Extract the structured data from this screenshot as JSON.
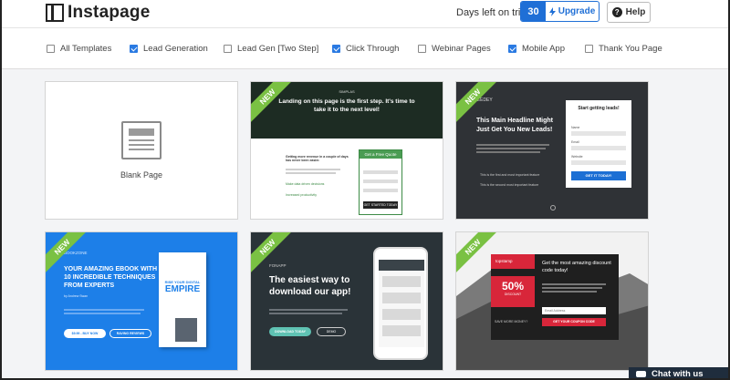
{
  "header": {
    "logo_text": "Instapage",
    "trial_label": "Days left on trial:",
    "trial_days": "30",
    "upgrade_label": "Upgrade",
    "help_label": "Help",
    "help_icon_glyph": "?"
  },
  "filters": [
    {
      "label": "All Templates",
      "checked": false
    },
    {
      "label": "Lead Generation",
      "checked": true
    },
    {
      "label": "Lead Gen [Two Step]",
      "checked": false
    },
    {
      "label": "Click Through",
      "checked": true
    },
    {
      "label": "Webinar Pages",
      "checked": false
    },
    {
      "label": "Mobile App",
      "checked": true
    },
    {
      "label": "Thank You Page",
      "checked": false
    }
  ],
  "templates": {
    "blank": {
      "label": "Blank Page"
    },
    "t2": {
      "ribbon": "NEW",
      "brand": "SIMPLAS",
      "headline": "Landing on this page is the first step. It's time to take it to the next level!",
      "sub": "Getting more revenue in a couple of days has never been easier.",
      "bullets": [
        "Make data driven decisions",
        "Increased productivity"
      ],
      "form_title": "Get a Free Quote",
      "form_button": "GET STARTED TODAY"
    },
    "t3": {
      "ribbon": "NEW",
      "brand": "LEEDEY",
      "headline": "This Main Headline Might Just Get You New Leads!",
      "bullets": [
        "This is the first and most important feature",
        "This is the second most important feature"
      ],
      "form_title": "Start getting leads!",
      "fields": [
        "Name",
        "Email",
        "Website"
      ],
      "form_button": "GET IT TODAY!"
    },
    "t4": {
      "ribbon": "NEW",
      "brand": "BOOKZONE",
      "headline": "YOUR AMAZING EBOOK WITH 10 INCREDIBLE TECHNIQUES FROM EXPERTS",
      "author": "by Andrew Swan",
      "buy_button": "$9.99 - BUY NOW",
      "reviews_button": "RAVING REVIEWS",
      "book_title": "RISE YOUR DIGITAL",
      "book_big": "EMPIRE"
    },
    "t5": {
      "ribbon": "NEW",
      "brand": "FONAPP",
      "headline": "The easiest way to download our app!",
      "download_button": "DOWNLOAD TODAY",
      "demo_button": "DEMO"
    },
    "t6": {
      "ribbon": "NEW",
      "brand": "topstamp",
      "headline": "Get the most amazing discount code today!",
      "discount": "50%",
      "discount_sub": "DISCOUNT",
      "save_text": "SAVE MORE MONEY?",
      "field": "Email Address",
      "coupon_button": "GET YOUR COUPON CODE"
    }
  },
  "chat": {
    "label": "Chat with us"
  },
  "colors": {
    "accent": "#1f6fd6",
    "ribbon": "#7ac143"
  }
}
